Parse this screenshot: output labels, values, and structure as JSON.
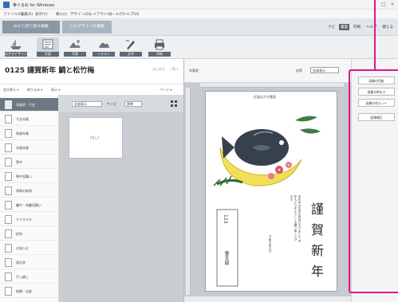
{
  "window": {
    "title": "筆ぐるめ for Windows"
  },
  "menu": [
    "ファイル(F)",
    "編集(E)",
    "表示(V)",
    "挿入(I)",
    "デザイン(D)",
    "レイアウト(L)",
    "ツール(T)",
    "ヘルプ(H)"
  ],
  "modes": {
    "tab1": "おもて(宛て面)の編集",
    "tab2": "うら(デザイン)の編集"
  },
  "top_tools": {
    "navi": "ナビ",
    "surface": "裏面",
    "print": "印刷",
    "help": "ヘルプ",
    "close": "閉じる"
  },
  "ribbon": [
    {
      "label": "はがきデザイン",
      "icon": "boat-icon"
    },
    {
      "label": "文面",
      "icon": "text-icon"
    },
    {
      "label": "写真",
      "icon": "photo-icon"
    },
    {
      "label": "イラスト",
      "icon": "illustration-icon"
    },
    {
      "label": "文字",
      "icon": "brush-icon"
    },
    {
      "label": "印刷",
      "icon": "printer-icon"
    }
  ],
  "template": {
    "title": "0125 謹賀新年 鯛と松竹梅",
    "btn_back": "元に戻す",
    "btn_list": "一覧へ"
  },
  "sortbar": {
    "sort": "並び替え ▾",
    "filter": "絞り込み ▾",
    "view": "表示 ▾",
    "page": "ページ ▾"
  },
  "categories": [
    "年賀状・干支",
    "干支年賀",
    "和風年賀",
    "洋風年賀",
    "喪中",
    "寒中見舞い",
    "季節の挨拶",
    "暑中・残暑見舞い",
    "クリスマス",
    "招待",
    "お知らせ",
    "案内状",
    "引っ越し",
    "結婚・出産"
  ],
  "thumbs": {
    "filter_select": "全般表示",
    "size_label": "サイズ",
    "size_select": "標準",
    "card_label": "(なし)"
  },
  "canvas": {
    "name": "年賀状",
    "zoom_label": "倍率",
    "zoom_value": "全体表示"
  },
  "postcard": {
    "top_label": "往復はがき書面",
    "greeting_char1": "謹",
    "greeting_char2": "賀",
    "greeting_char3": "新",
    "greeting_char4": "年",
    "message": "旧年中は大変お世話になりました 本年もどうぞよろしくお願い申し上げます",
    "year_line": "令和七年元旦",
    "sender_postcode": "123",
    "sender_name": "筆太郎"
  },
  "right_panel": {
    "btn1": "画像の切抜",
    "btn2": "画像の明るさ",
    "btn3": "画像の枠カット",
    "btn4": "画像補正"
  }
}
